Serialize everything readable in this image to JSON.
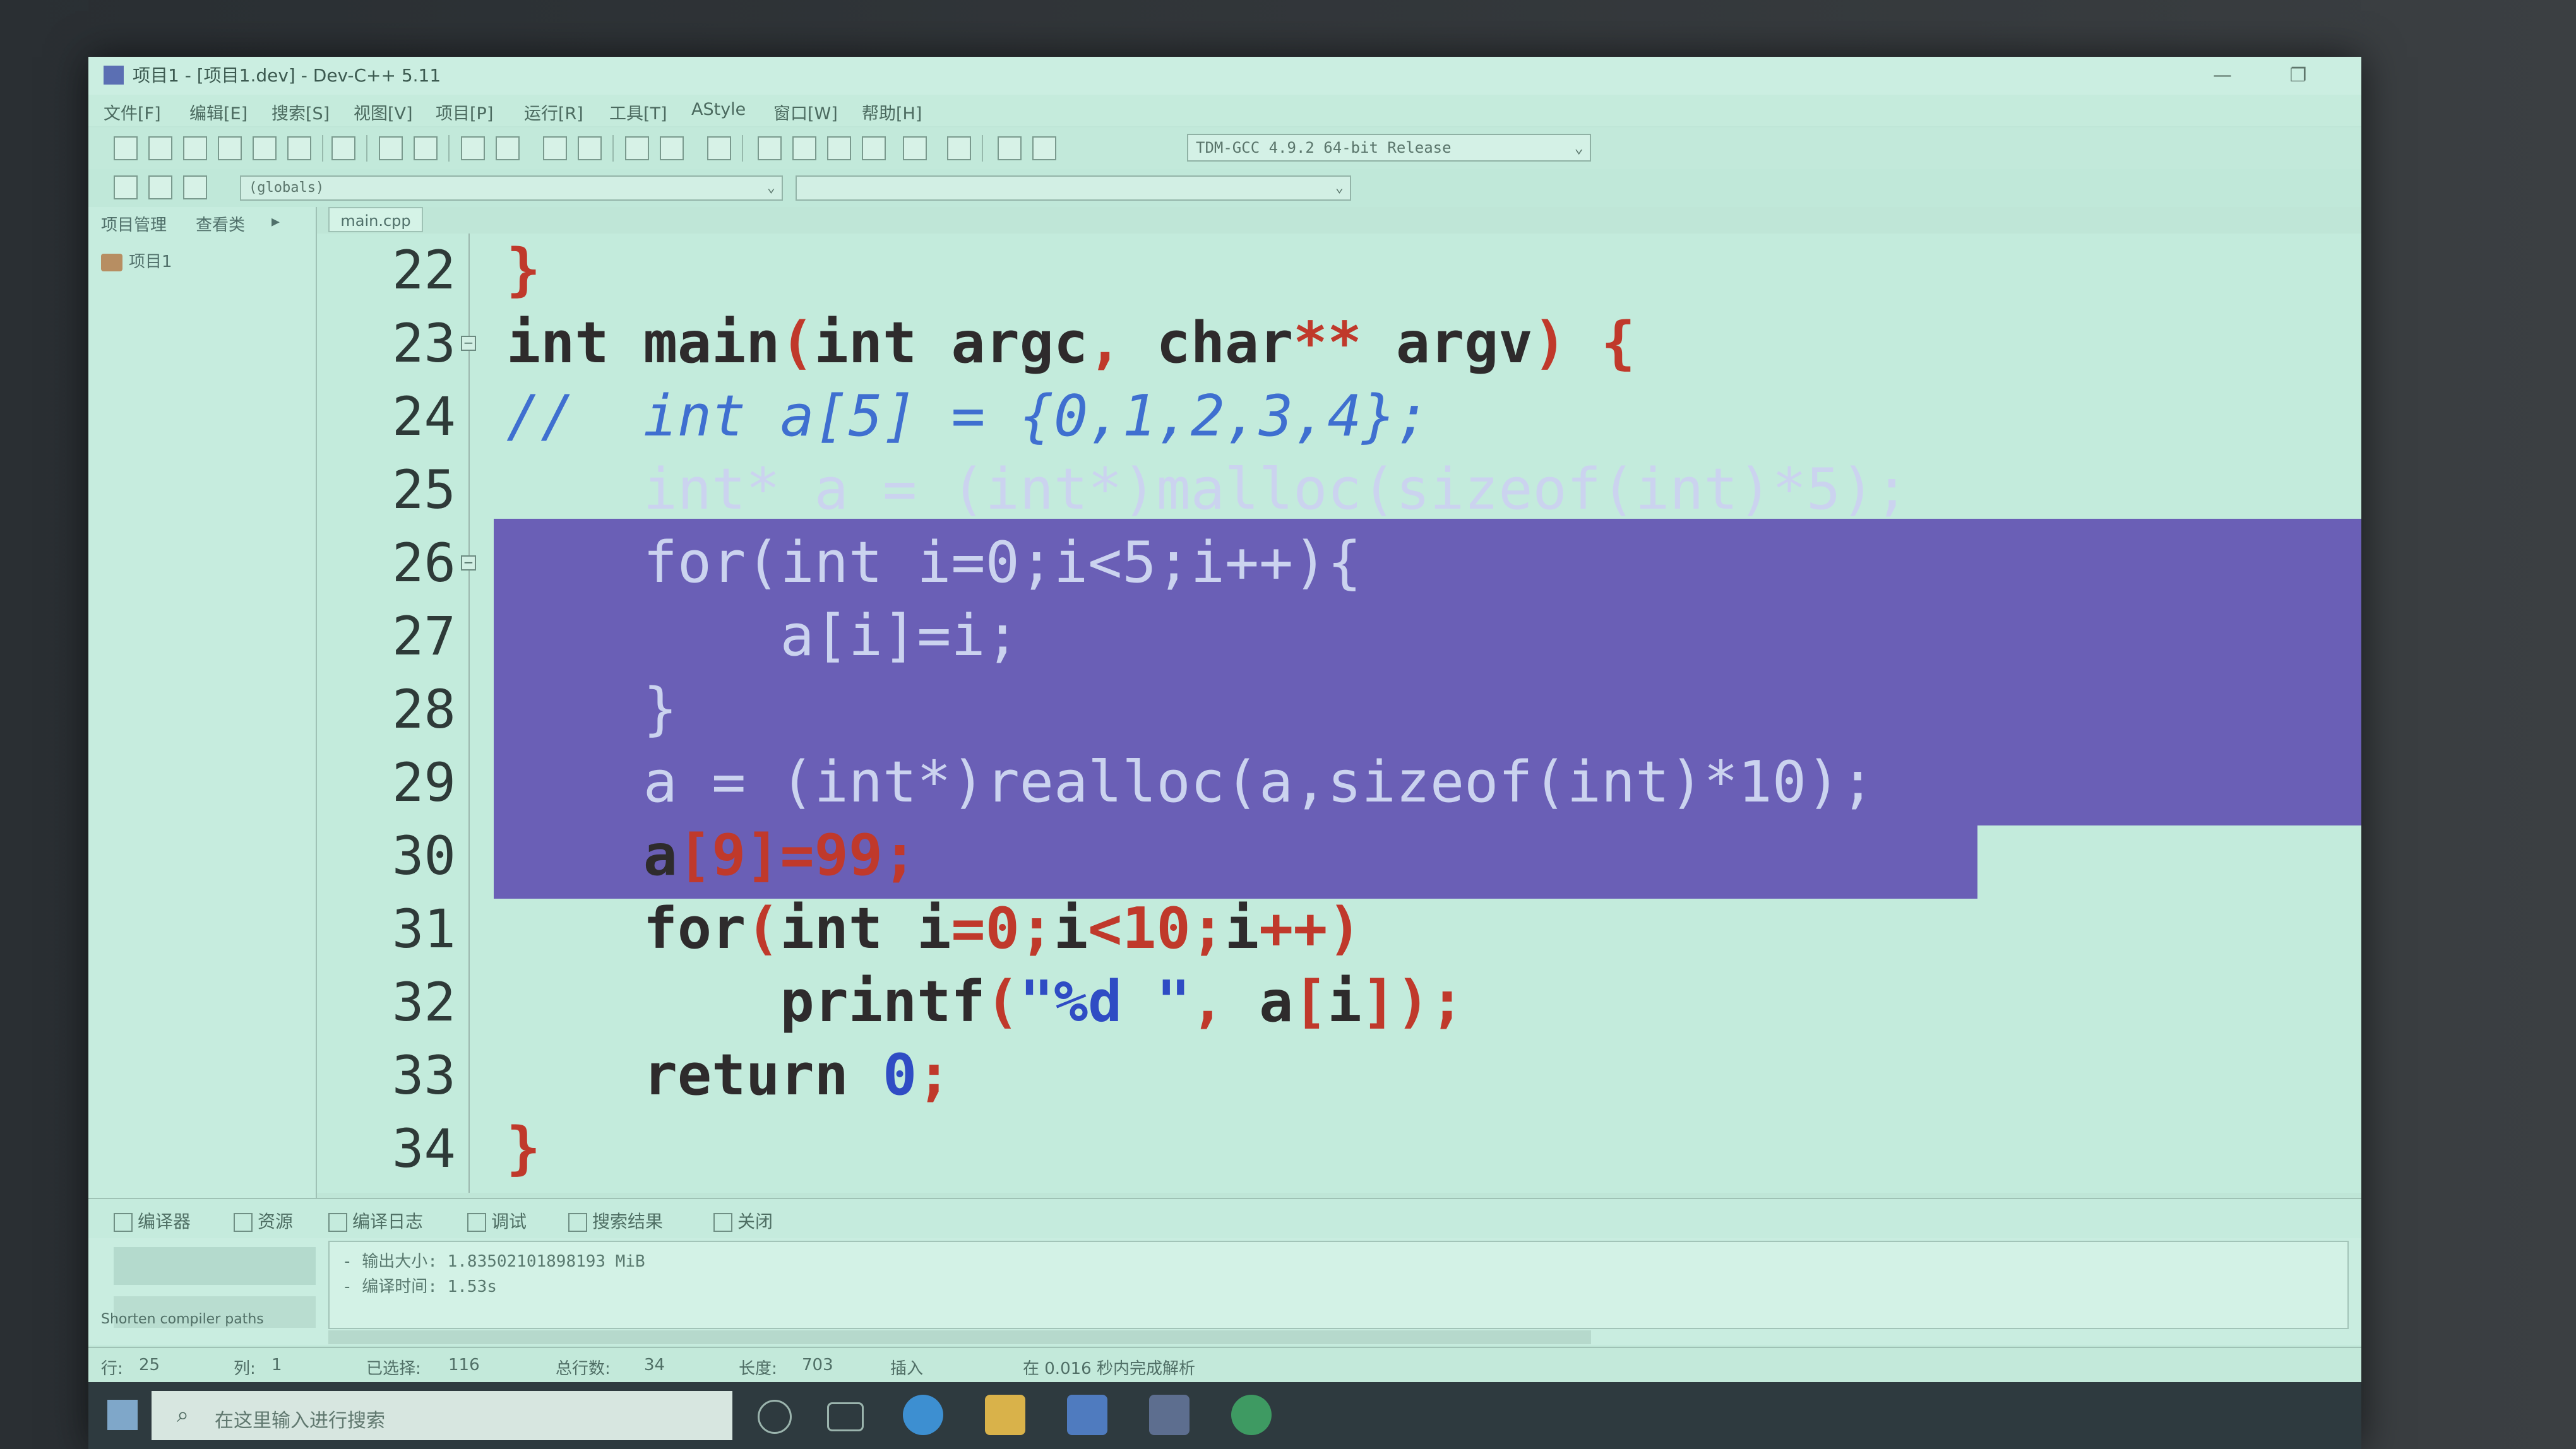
{
  "window": {
    "title": "项目1 - [项目1.dev] - Dev-C++ 5.11",
    "minimize": "—",
    "restore": "❐"
  },
  "menu": [
    "文件[F]",
    "编辑[E]",
    "搜索[S]",
    "视图[V]",
    "项目[P]",
    "运行[R]",
    "工具[T]",
    "AStyle",
    "窗口[W]",
    "帮助[H]"
  ],
  "toolbar": {
    "compiler": "TDM-GCC 4.9.2 64-bit Release",
    "scope": "(globals)",
    "member": ""
  },
  "side_panel": {
    "tabs": [
      "项目管理",
      "查看类"
    ],
    "tree_root": "项目1"
  },
  "editor": {
    "tab": "main.cpp",
    "lines": [
      {
        "num": "22",
        "segments": [
          {
            "t": "}",
            "c": "red"
          }
        ]
      },
      {
        "num": "23",
        "segments": [
          {
            "t": "int main",
            "c": "kw"
          },
          {
            "t": "(",
            "c": "red"
          },
          {
            "t": "int argc",
            "c": "kw"
          },
          {
            "t": ", ",
            "c": "red"
          },
          {
            "t": "char",
            "c": "kw"
          },
          {
            "t": "** ",
            "c": "red"
          },
          {
            "t": "argv",
            "c": "kw"
          },
          {
            "t": ") {",
            "c": "red"
          }
        ]
      },
      {
        "num": "24",
        "segments": [
          {
            "t": "//  int a[5] = {0,1,2,3,4};",
            "c": "cmt"
          }
        ]
      },
      {
        "num": "25",
        "selected": true,
        "segments": [
          {
            "t": "    int* a = (int*)malloc(sizeof(int)*5);",
            "c": ""
          }
        ]
      },
      {
        "num": "26",
        "selected": true,
        "segments": [
          {
            "t": "    for(int i=0;i<5;i++){",
            "c": ""
          }
        ]
      },
      {
        "num": "27",
        "selected": true,
        "segments": [
          {
            "t": "        a[i]=i;",
            "c": ""
          }
        ]
      },
      {
        "num": "28",
        "selected": true,
        "segments": [
          {
            "t": "    }",
            "c": ""
          }
        ]
      },
      {
        "num": "29",
        "selected": true,
        "segments": [
          {
            "t": "    a = (int*)realloc(a,sizeof(int)*10);",
            "c": ""
          }
        ]
      },
      {
        "num": "30",
        "segments": [
          {
            "t": "    a",
            "c": "kw"
          },
          {
            "t": "[9]=99;",
            "c": "red"
          }
        ]
      },
      {
        "num": "31",
        "segments": [
          {
            "t": "    for",
            "c": "kw"
          },
          {
            "t": "(",
            "c": "red"
          },
          {
            "t": "int i",
            "c": "kw"
          },
          {
            "t": "=0;",
            "c": "red"
          },
          {
            "t": "i",
            "c": "kw"
          },
          {
            "t": "<10;",
            "c": "red"
          },
          {
            "t": "i",
            "c": "kw"
          },
          {
            "t": "++)",
            "c": "red"
          }
        ]
      },
      {
        "num": "32",
        "segments": [
          {
            "t": "        printf",
            "c": "kw"
          },
          {
            "t": "(",
            "c": "red"
          },
          {
            "t": "\"%d \"",
            "c": "str"
          },
          {
            "t": ", ",
            "c": "red"
          },
          {
            "t": "a",
            "c": "kw"
          },
          {
            "t": "[",
            "c": "red"
          },
          {
            "t": "i",
            "c": "kw"
          },
          {
            "t": "]);",
            "c": "red"
          }
        ]
      },
      {
        "num": "33",
        "segments": [
          {
            "t": "    return ",
            "c": "kw"
          },
          {
            "t": "0",
            "c": "str"
          },
          {
            "t": ";",
            "c": "red"
          }
        ]
      },
      {
        "num": "34",
        "segments": [
          {
            "t": "}",
            "c": "red"
          }
        ]
      }
    ]
  },
  "bottom_tabs": [
    "编译器",
    "资源",
    "编译日志",
    "调试",
    "搜索结果",
    "关闭"
  ],
  "output": {
    "lines": [
      "- 输出大小: 1.83502101898193 MiB",
      "- 编译时间: 1.53s"
    ],
    "shorten_paths": "Shorten compiler paths"
  },
  "status": {
    "row_label": "行:",
    "row": "25",
    "col_label": "列:",
    "col": "1",
    "selected_label": "已选择:",
    "selected": "116",
    "total_label": "总行数:",
    "total": "34",
    "length_label": "长度:",
    "length": "703",
    "mode": "插入",
    "parse": "在 0.016 秒内完成解析"
  },
  "taskbar": {
    "search_placeholder": "在这里输入进行搜索"
  }
}
